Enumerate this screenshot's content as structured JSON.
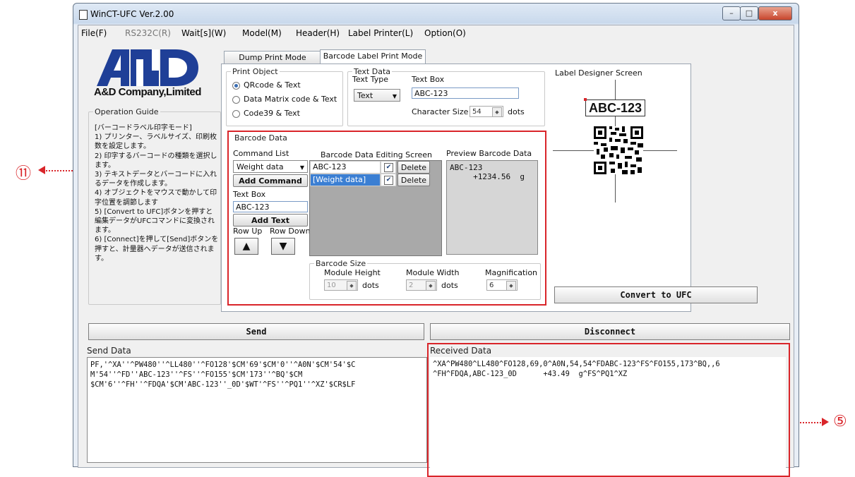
{
  "window": {
    "title": "WinCT-UFC  Ver.2.00",
    "minimize": "–",
    "maximize": "□",
    "close": "x"
  },
  "menu": [
    {
      "label": "File(F)",
      "enabled": true
    },
    {
      "label": "RS232C(R)",
      "enabled": false
    },
    {
      "label": "Wait[s](W)",
      "enabled": true
    },
    {
      "label": "Model(M)",
      "enabled": true
    },
    {
      "label": "Header(H)",
      "enabled": true
    },
    {
      "label": "Label Printer(L)",
      "enabled": true
    },
    {
      "label": "Option(O)",
      "enabled": true
    }
  ],
  "brand": {
    "company": "A&D Company,Limited"
  },
  "guide": {
    "title": "Operation Guide",
    "text": "[バーコードラベル印字モード]\n1) プリンター、ラベルサイズ、印刷枚数を設定します。\n2) 印字するバーコードの種類を選択します。\n3) テキストデータとバーコードに入れるデータを作成します。\n4) オブジェクトをマウスで動かして印字位置を調節します\n5) [Convert to UFC]ボタンを押すと編集データがUFCコマンドに変換されます。\n6) [Connect]を押して[Send]ボタンを押すと、計量器へデータが送信されます。"
  },
  "tabs": {
    "dump": "Dump Print Mode",
    "barcode": "Barcode Label Print Mode"
  },
  "print_object": {
    "title": "Print Object",
    "options": [
      "QRcode  &  Text",
      "Data Matrix code  &  Text",
      "Code39  &  Text"
    ],
    "selected": 0
  },
  "text_data": {
    "title": "Text Data",
    "type_label": "Text Type",
    "type_value": "Text",
    "box_label": "Text Box",
    "box_value": "ABC-123",
    "size_label": "Character Size",
    "size_value": "54",
    "size_unit": "dots"
  },
  "barcode_data": {
    "title": "Barcode Data",
    "command_list_label": "Command List",
    "command_value": "Weight data",
    "add_command": "Add Command",
    "text_box_label": "Text Box",
    "text_box_value": "ABC-123",
    "add_text": "Add Text",
    "row_up": "Row Up",
    "row_down": "Row Down",
    "up_glyph": "▲",
    "down_glyph": "▼",
    "editing_title": "Barcode Data Editing Screen",
    "rows": [
      {
        "text": "ABC-123",
        "checked": true,
        "delete": "Delete",
        "selected": false
      },
      {
        "text": "[Weight data]",
        "checked": true,
        "delete": "Delete",
        "selected": true
      }
    ],
    "preview_title": "Preview Barcode Data",
    "preview_text": "ABC-123\n     +1234.56  g"
  },
  "barcode_size": {
    "title": "Barcode Size",
    "module_height_label": "Module Height",
    "module_height_value": "10",
    "module_width_label": "Module Width",
    "module_width_value": "2",
    "unit": "dots",
    "magnification_label": "Magnification",
    "magnification_value": "6"
  },
  "designer": {
    "title": "Label Designer Screen",
    "label_text": "ABC-123"
  },
  "buttons": {
    "convert": "Convert to UFC",
    "send": "Send",
    "disconnect": "Disconnect"
  },
  "send_data": {
    "label": "Send Data",
    "text": "PF,'^XA''^PW480''^LL480''^FO128'$CM'69'$CM'0''^A0N'$CM'54'$C\nM'54''^FD''ABC-123''^FS''^FO155'$CM'173''^BQ'$CM\n$CM'6''^FH''^FDQA'$CM'ABC-123''_0D'$WT'^FS''^PQ1''^XZ'$CR$LF"
  },
  "received_data": {
    "label": "Received Data",
    "text": "^XA^PW480^LL480^FO128,69,0^A0N,54,54^FDABC-123^FS^FO155,173^BQ,,6\n^FH^FDQA,ABC-123_0D      +43.49  g^FS^PQ1^XZ"
  },
  "callouts": {
    "left": "⑪",
    "right": "⑤"
  },
  "colors": {
    "callout_red": "#d9252a",
    "selection_blue": "#3b7fd3"
  }
}
